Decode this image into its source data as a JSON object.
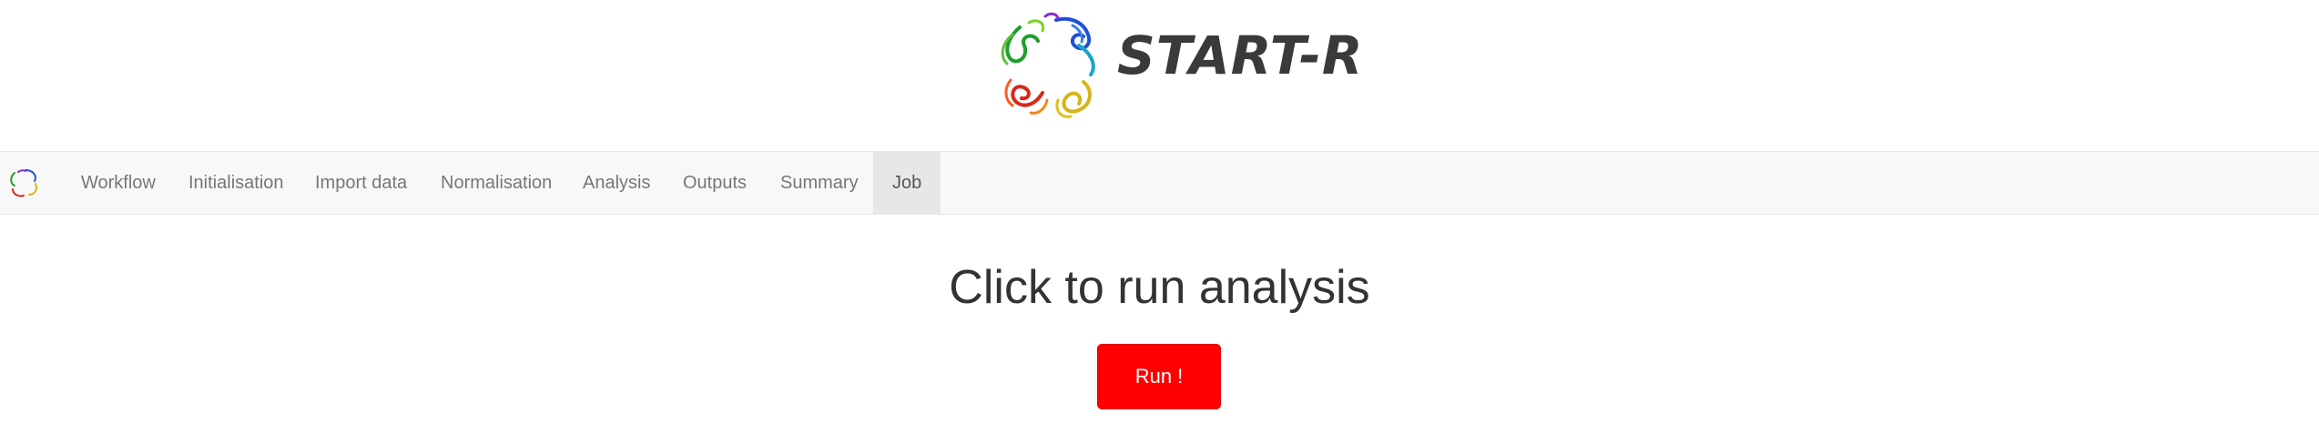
{
  "header": {
    "title": "START-R",
    "logo_icon": "protein-ring-logo-icon"
  },
  "navbar": {
    "brand_icon": "protein-ring-logo-icon",
    "items": [
      {
        "label": "Workflow"
      },
      {
        "label": "Initialisation"
      },
      {
        "label": "Import data"
      },
      {
        "label": "Normalisation"
      },
      {
        "label": "Analysis"
      },
      {
        "label": "Outputs"
      },
      {
        "label": "Summary"
      },
      {
        "label": "Job",
        "active": true
      }
    ]
  },
  "main": {
    "title": "Click to run analysis",
    "run_button_label": "Run !"
  },
  "colors": {
    "run_button": "#ff0000",
    "navbar_bg": "#f8f8f8",
    "active_tab_bg": "#e7e7e7"
  }
}
